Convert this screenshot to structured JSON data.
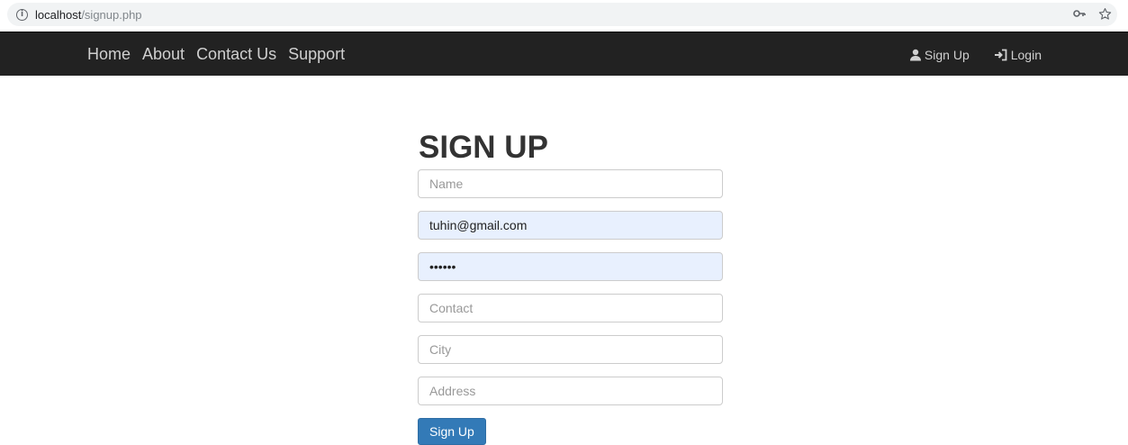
{
  "browser": {
    "url_host": "localhost",
    "url_path": "/signup.php"
  },
  "navbar": {
    "left_links": [
      "Home",
      "About",
      "Contact Us",
      "Support"
    ],
    "signup_label": "Sign Up",
    "login_label": "Login"
  },
  "form": {
    "title": "SIGN UP",
    "name_placeholder": "Name",
    "email_value": "tuhin@gmail.com",
    "password_value": "tuhin1",
    "contact_placeholder": "Contact",
    "city_placeholder": "City",
    "address_placeholder": "Address",
    "submit_label": "Sign Up"
  },
  "colors": {
    "navbar_bg": "#222222",
    "primary": "#337ab7",
    "autofill_bg": "#e8f0fe"
  }
}
